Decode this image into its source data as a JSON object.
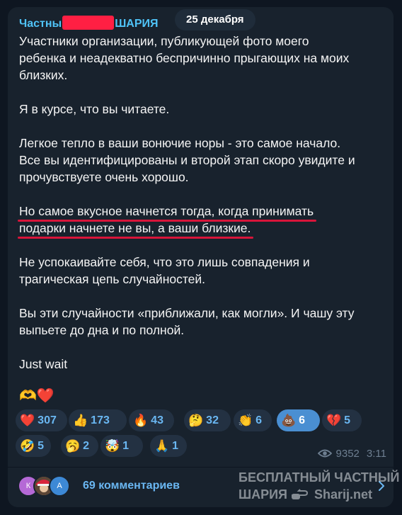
{
  "message": {
    "sender_visible_start": "Частны",
    "sender_visible_end": "ШАРИЯ",
    "date": "25 декабря",
    "lines": [
      "Участники организации, публикующей фото моего",
      "ребенка и неадекватно беспричинно прыгающих на моих",
      "близких.",
      "",
      "Я в курсе, что вы читаете.",
      "",
      "Легкое тепло в ваши вонючие норы - это самое начало.",
      "Все вы идентифицированы и второй этап скоро увидите и",
      "прочувствуете очень хорошо.",
      "",
      "Но самое вкусное начнется тогда, когда принимать",
      "подарки начнете не вы, а ваши близкие.",
      "",
      "Не успокаивайте себя, что это лишь совпадения и",
      "трагическая цепь случайностей.",
      "",
      "Вы эти случайности «приближали, как могли». И чашу эту",
      "выпьете до дна и по полной.",
      "",
      "Just wait"
    ],
    "underlined_line_indexes": [
      10,
      11
    ],
    "emoji_line": "🫶❤️"
  },
  "reactions": [
    {
      "emoji": "❤️",
      "count": "307",
      "active": false
    },
    {
      "emoji": "👍",
      "count": "173",
      "active": false
    },
    {
      "emoji": "🔥",
      "count": "43",
      "active": false
    },
    {
      "emoji": "🤔",
      "count": "32",
      "active": false
    },
    {
      "emoji": "👏",
      "count": "6",
      "active": false
    },
    {
      "emoji": "💩",
      "count": "6",
      "active": true
    },
    {
      "emoji": "💔",
      "count": "5",
      "active": false
    },
    {
      "emoji": "🤣",
      "count": "5",
      "active": false
    },
    {
      "emoji": "🥱",
      "count": "2",
      "active": false
    },
    {
      "emoji": "🤯",
      "count": "1",
      "active": false
    },
    {
      "emoji": "🙏",
      "count": "1",
      "active": false
    }
  ],
  "meta": {
    "views": "9352",
    "time": "3:11",
    "views_icon": "eye-icon"
  },
  "comments": {
    "avatars": [
      "К",
      "photo",
      "А"
    ],
    "label": "69 комментариев",
    "icon": "chevron-right-icon"
  },
  "watermark": {
    "line1": "БЕСПЛАТНЫЙ ЧАСТНЫЙ",
    "line2a": "ШАРИЯ",
    "line2b": "Sharij.net"
  },
  "colors": {
    "background": "#0e1621",
    "bubble": "#18222d",
    "accent": "#6ab7f2",
    "active_reaction": "#4a8fd2",
    "underline": "#d8153a",
    "redaction": "#ff1f43"
  }
}
